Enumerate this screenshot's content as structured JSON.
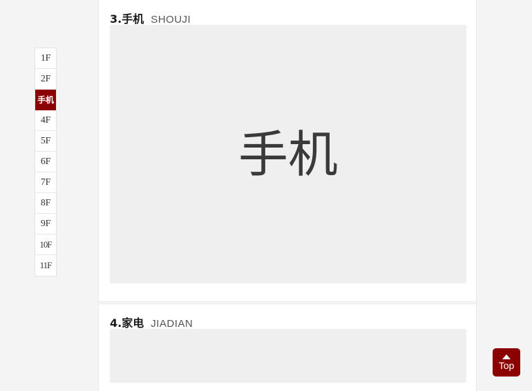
{
  "floor_nav": {
    "items": [
      {
        "label": "1F",
        "active": false
      },
      {
        "label": "2F",
        "active": false
      },
      {
        "label": "手机",
        "active": true
      },
      {
        "label": "4F",
        "active": false
      },
      {
        "label": "5F",
        "active": false
      },
      {
        "label": "6F",
        "active": false
      },
      {
        "label": "7F",
        "active": false
      },
      {
        "label": "8F",
        "active": false
      },
      {
        "label": "9F",
        "active": false
      },
      {
        "label": "10F",
        "active": false
      },
      {
        "label": "11F",
        "active": false
      }
    ],
    "active_index": 2
  },
  "sections": [
    {
      "index_label": "3.",
      "title_cn": "手机",
      "title_en": "SHOUJI",
      "header_full": "3.手机",
      "placeholder_text": "手机"
    },
    {
      "index_label": "4.",
      "title_cn": "家电",
      "title_en": "JIADIAN",
      "header_full": "4.家电",
      "placeholder_text": ""
    }
  ],
  "back_to_top": {
    "label": "Top",
    "icon": "triangle-up-icon"
  },
  "colors": {
    "accent_red": "#8b0000",
    "page_background": "#f4f4f4",
    "content_background": "#ffffff",
    "placeholder_background": "#efefef",
    "placeholder_text": "#3a3a3a",
    "title_cn": "#1a1a1a",
    "title_en": "#555555",
    "border": "#e8e8e8"
  }
}
